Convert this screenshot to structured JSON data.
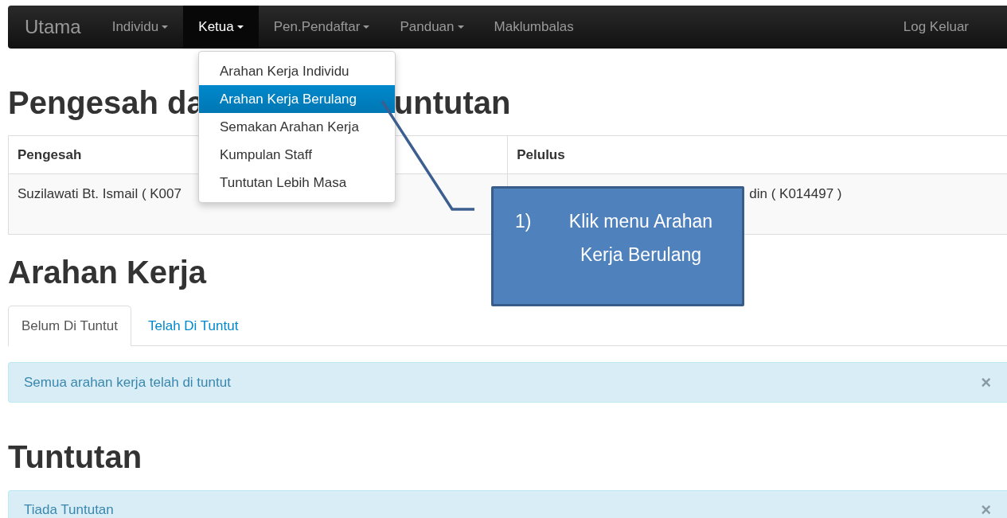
{
  "navbar": {
    "brand": "Utama",
    "items": [
      {
        "label": "Individu",
        "caret": true,
        "selected": false
      },
      {
        "label": "Ketua",
        "caret": true,
        "selected": true
      },
      {
        "label": "Pen.Pendaftar",
        "caret": true,
        "selected": false
      },
      {
        "label": "Panduan",
        "caret": true,
        "selected": false
      },
      {
        "label": "Maklumbalas",
        "caret": false,
        "selected": false
      }
    ],
    "logout": "Log Keluar"
  },
  "dropdown": {
    "items": [
      {
        "label": "Arahan Kerja Individu",
        "selected": false
      },
      {
        "label": "Arahan Kerja Berulang",
        "selected": true
      },
      {
        "label": "Semakan Arahan Kerja",
        "selected": false
      },
      {
        "label": "Kumpulan Staff",
        "selected": false
      },
      {
        "label": "Tuntutan Lebih Masa",
        "selected": false
      }
    ]
  },
  "heading_1": {
    "parts": [
      "Pengesah da",
      "untutan"
    ]
  },
  "table": {
    "columns": [
      "Pengesah",
      "Pelulus"
    ],
    "rows": [
      [
        "Suzilawati Bt. Ismail ( K007",
        "din ( K014497 )"
      ]
    ]
  },
  "heading_2": "Arahan Kerja",
  "tabs": [
    {
      "label": "Belum Di Tuntut",
      "selected": true
    },
    {
      "label": "Telah Di Tuntut",
      "selected": false
    }
  ],
  "alert_1": {
    "text": "Semua arahan kerja telah di tuntut",
    "close": "×"
  },
  "heading_3": "Tuntutan",
  "alert_2": {
    "text": "Tiada Tuntutan",
    "close": "×"
  },
  "callout": {
    "number": "1)",
    "text": "Klik menu Arahan Kerja Berulang"
  }
}
